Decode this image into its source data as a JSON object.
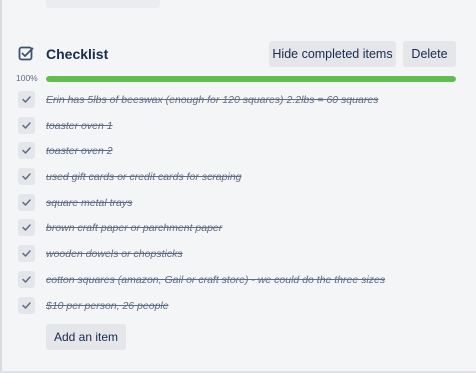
{
  "checklist": {
    "title": "Checklist",
    "hide_completed_label": "Hide completed items",
    "delete_label": "Delete",
    "progress_label": "100%",
    "progress_value": 1.0,
    "progress_color": "#61bd4f",
    "add_item_label": "Add an item",
    "items": [
      {
        "text": "Erin has 5lbs of beeswax (enough for 120 squares) 2.2lbs = 60 squares",
        "checked": true
      },
      {
        "text": "toaster oven 1",
        "checked": true
      },
      {
        "text": "toaster oven 2",
        "checked": true
      },
      {
        "text": "used gift cards or credit cards for scraping",
        "checked": true
      },
      {
        "text": "square metal trays",
        "checked": true
      },
      {
        "text": "brown craft paper or parchment paper",
        "checked": true
      },
      {
        "text": "wooden dowels or chopsticks",
        "checked": true
      },
      {
        "text": "cotton squares (amazon, Gail or craft store) - we could do the three sizes",
        "checked": true
      },
      {
        "text": "$10 per person, 26 people",
        "checked": true
      }
    ]
  },
  "icons": {
    "header": "checklist-icon",
    "item": "checkmark-icon"
  }
}
